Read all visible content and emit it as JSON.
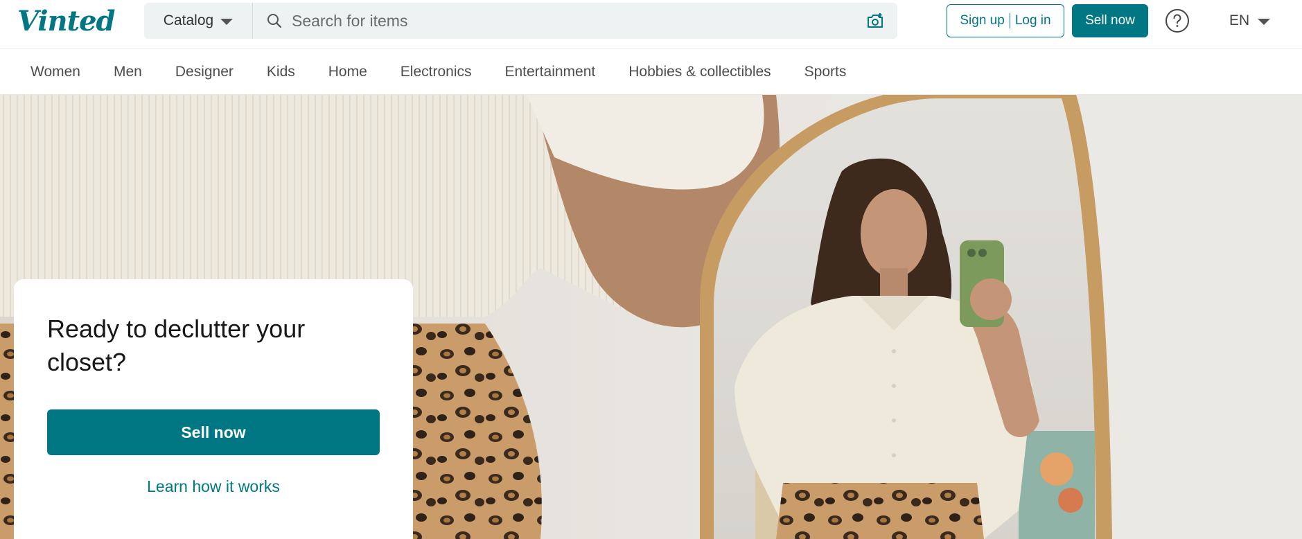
{
  "header": {
    "logo_text": "Vinted",
    "catalog_label": "Catalog",
    "search_placeholder": "Search for items",
    "sign_up_label": "Sign up",
    "log_in_label": "Log in",
    "sell_now_label": "Sell now",
    "help_icon": "question-circle-icon",
    "language_label": "EN"
  },
  "nav": {
    "items": [
      "Women",
      "Men",
      "Designer",
      "Kids",
      "Home",
      "Electronics",
      "Entertainment",
      "Hobbies & collectibles",
      "Sports"
    ]
  },
  "hero": {
    "title": "Ready to declutter your closet?",
    "sell_button_label": "Sell now",
    "learn_link_label": "Learn how it works",
    "image_description_icon": "hero-photo"
  },
  "colors": {
    "brand": "#007782",
    "search_bg": "#eef2f2",
    "text_muted": "#4d4d4d"
  }
}
